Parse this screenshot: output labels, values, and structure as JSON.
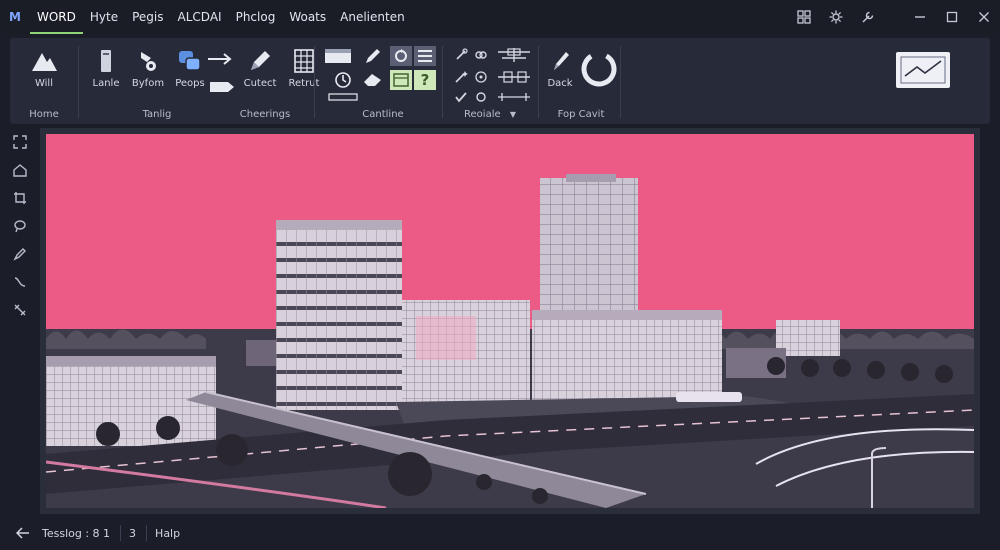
{
  "menubar": {
    "logo": "M",
    "items": [
      "WORD",
      "Hyte",
      "Pegis",
      "ALCDAI",
      "Phclog",
      "Woats",
      "Anelienten"
    ]
  },
  "ribbon": {
    "groups": {
      "home": {
        "label": "Home",
        "tool": "Will"
      },
      "tanlig": {
        "label": "Tanlig",
        "tools": [
          "Lanle",
          "Byfom",
          "Peops"
        ]
      },
      "cheerings": {
        "label": "Cheerings",
        "tools": [
          "Cutect",
          "Retrut"
        ]
      },
      "cantline": {
        "label": "Cantline",
        "help_glyph": "?"
      },
      "reoiale": {
        "label": "Reoiale"
      },
      "topcavit": {
        "label": "Fop Cavit",
        "tool": "Dack"
      }
    }
  },
  "statusbar": {
    "back_icon": "arrow-left-icon",
    "status_text": "Tesslog : 8 1",
    "count": "3",
    "help": "Halp"
  },
  "colors": {
    "sky": "#ec5a86",
    "accent_green": "#8fd47a",
    "accent_blue": "#7fa6ff",
    "panel": "#272a38"
  }
}
